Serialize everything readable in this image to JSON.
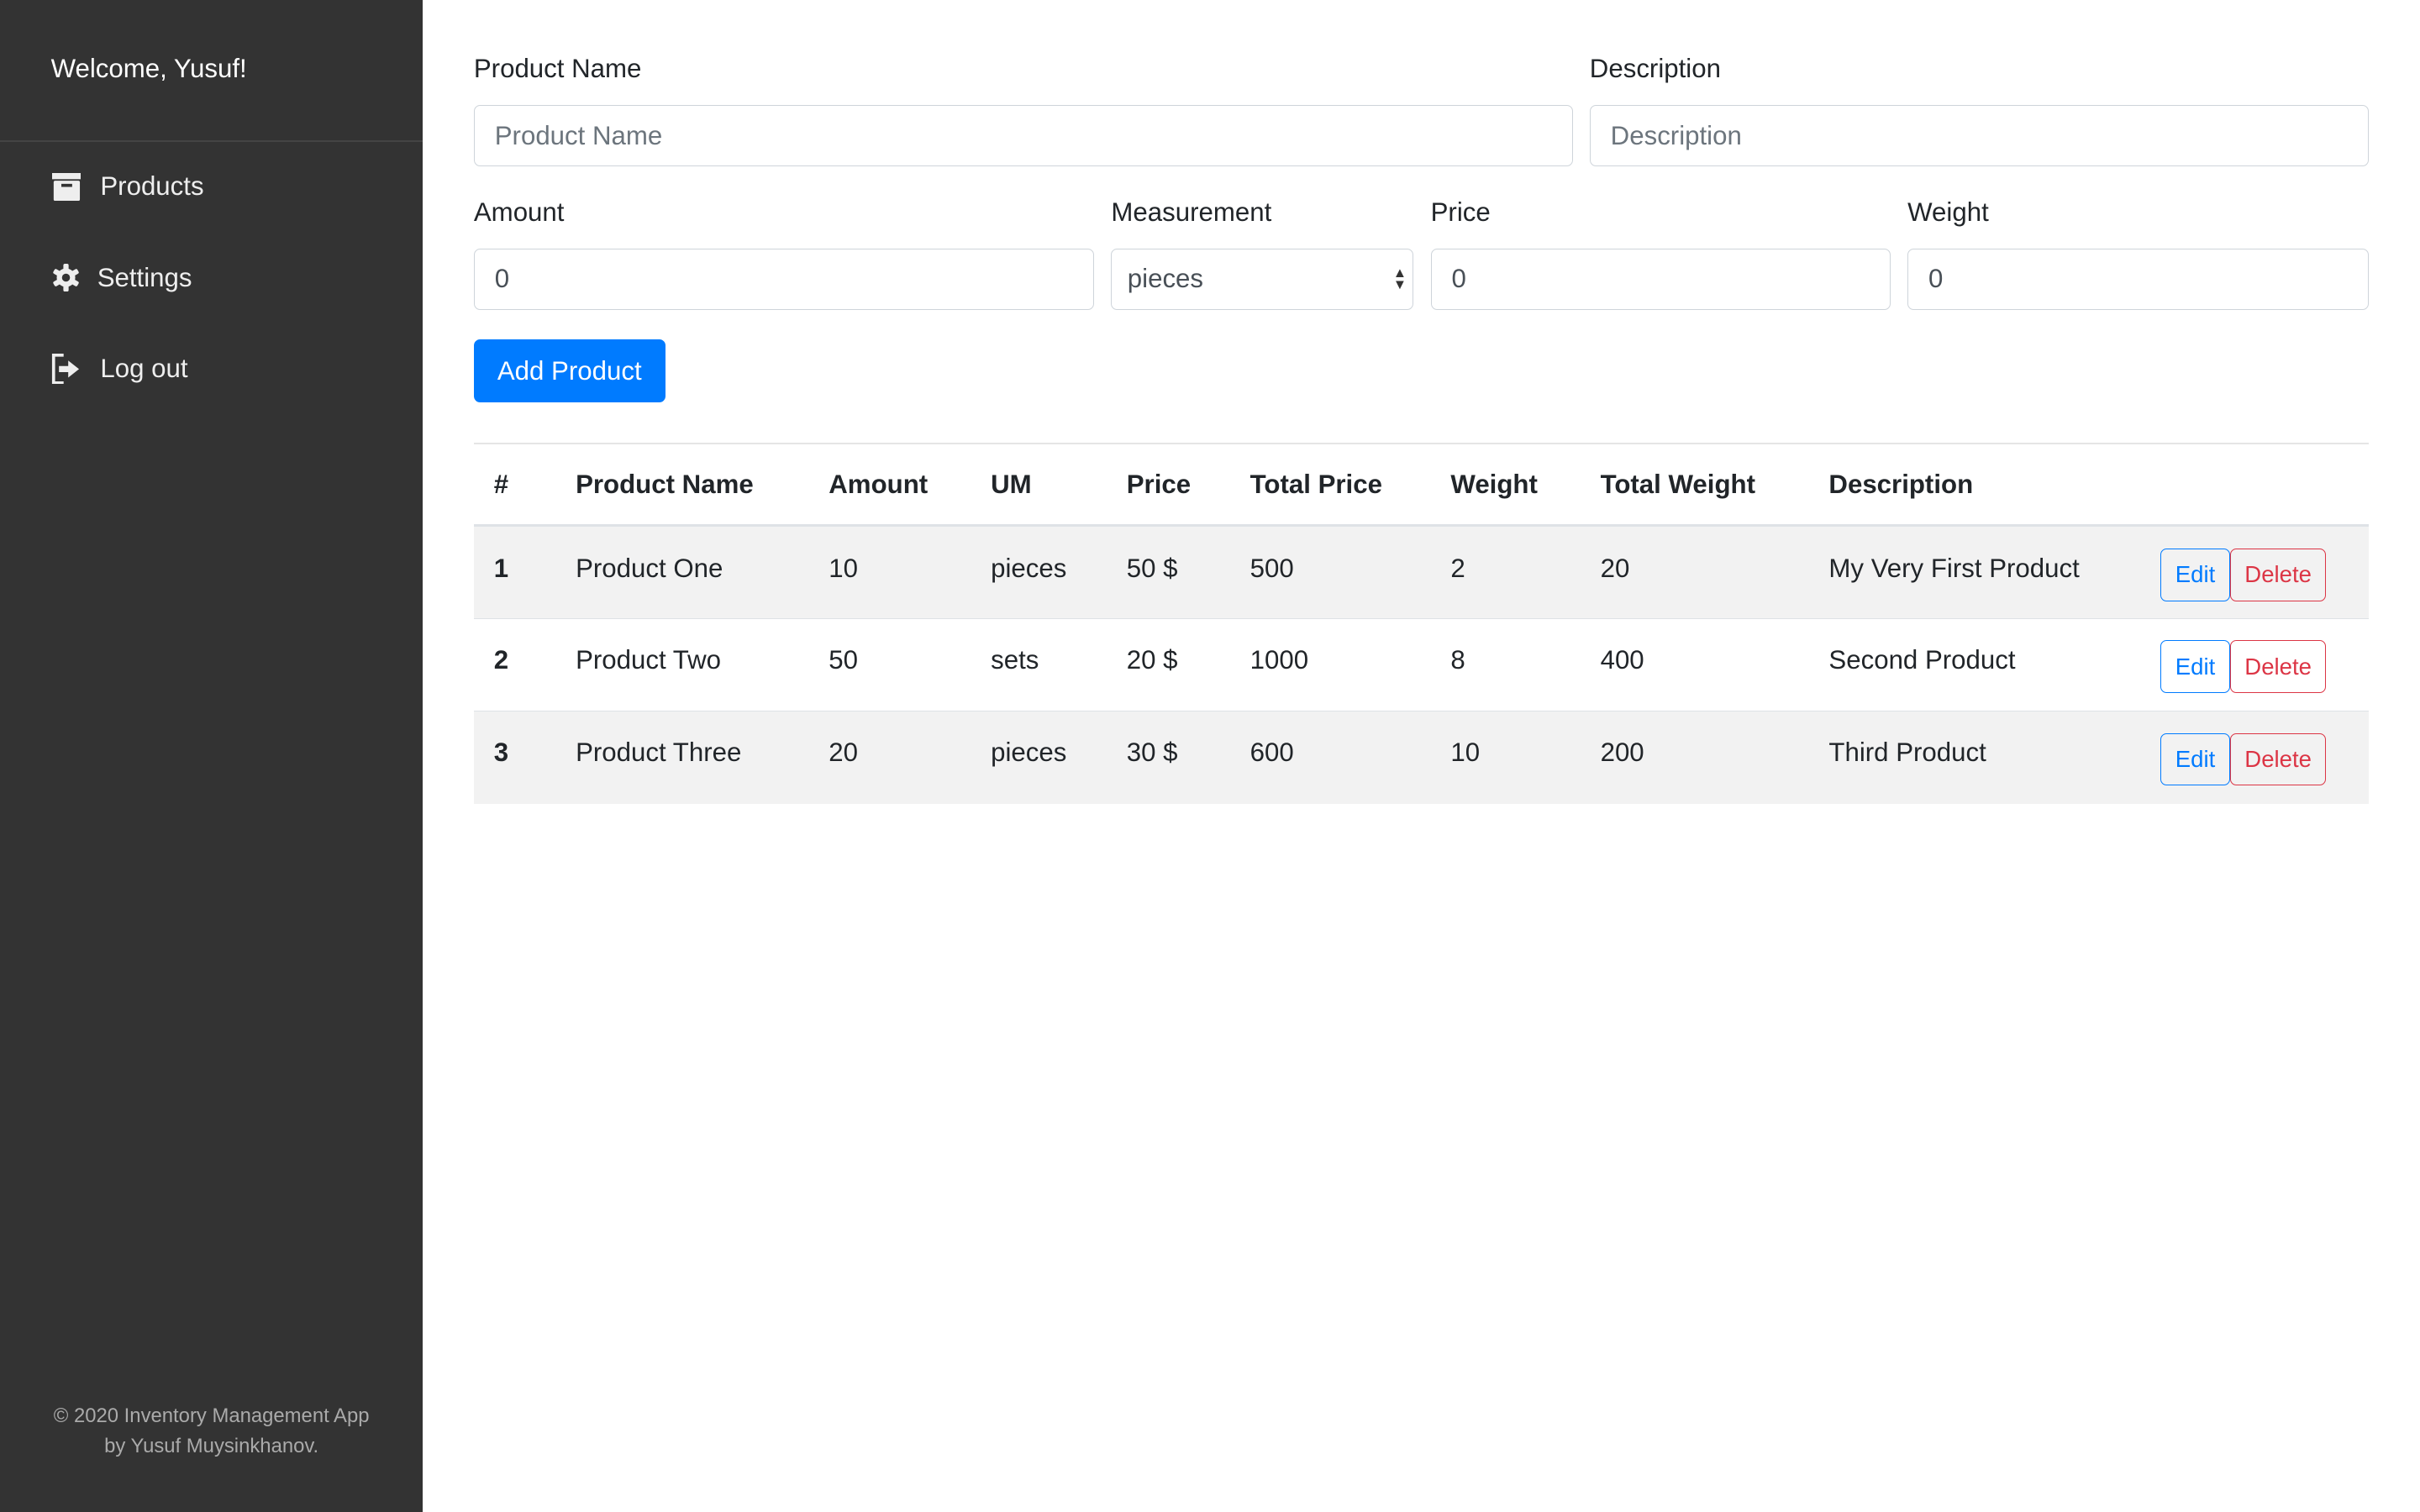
{
  "sidebar": {
    "welcome": "Welcome, Yusuf!",
    "items": [
      {
        "label": "Products",
        "icon": "archive-icon"
      },
      {
        "label": "Settings",
        "icon": "gear-icon"
      },
      {
        "label": "Log out",
        "icon": "sign-out-icon"
      }
    ],
    "footer_line1": "© 2020 Inventory Management App",
    "footer_line2": "by Yusuf Muysinkhanov."
  },
  "form": {
    "product_name": {
      "label": "Product Name",
      "placeholder": "Product Name",
      "value": ""
    },
    "description": {
      "label": "Description",
      "placeholder": "Description",
      "value": ""
    },
    "amount": {
      "label": "Amount",
      "value": "0"
    },
    "measurement": {
      "label": "Measurement",
      "value": "pieces"
    },
    "price": {
      "label": "Price",
      "value": "0"
    },
    "weight": {
      "label": "Weight",
      "value": "0"
    },
    "add_button": "Add Product"
  },
  "table": {
    "headers": [
      "#",
      "Product Name",
      "Amount",
      "UM",
      "Price",
      "Total Price",
      "Weight",
      "Total Weight",
      "Description",
      ""
    ],
    "rows": [
      {
        "num": "1",
        "name": "Product One",
        "amount": "10",
        "um": "pieces",
        "price": "50 $",
        "total_price": "500",
        "weight": "2",
        "total_weight": "20",
        "description": "My Very First Product"
      },
      {
        "num": "2",
        "name": "Product Two",
        "amount": "50",
        "um": "sets",
        "price": "20 $",
        "total_price": "1000",
        "weight": "8",
        "total_weight": "400",
        "description": "Second Product"
      },
      {
        "num": "3",
        "name": "Product Three",
        "amount": "20",
        "um": "pieces",
        "price": "30 $",
        "total_price": "600",
        "weight": "10",
        "total_weight": "200",
        "description": "Third Product"
      }
    ],
    "edit_label": "Edit",
    "delete_label": "Delete"
  },
  "colors": {
    "sidebar": "#333333",
    "primary": "#007bff",
    "danger": "#dc3545"
  }
}
